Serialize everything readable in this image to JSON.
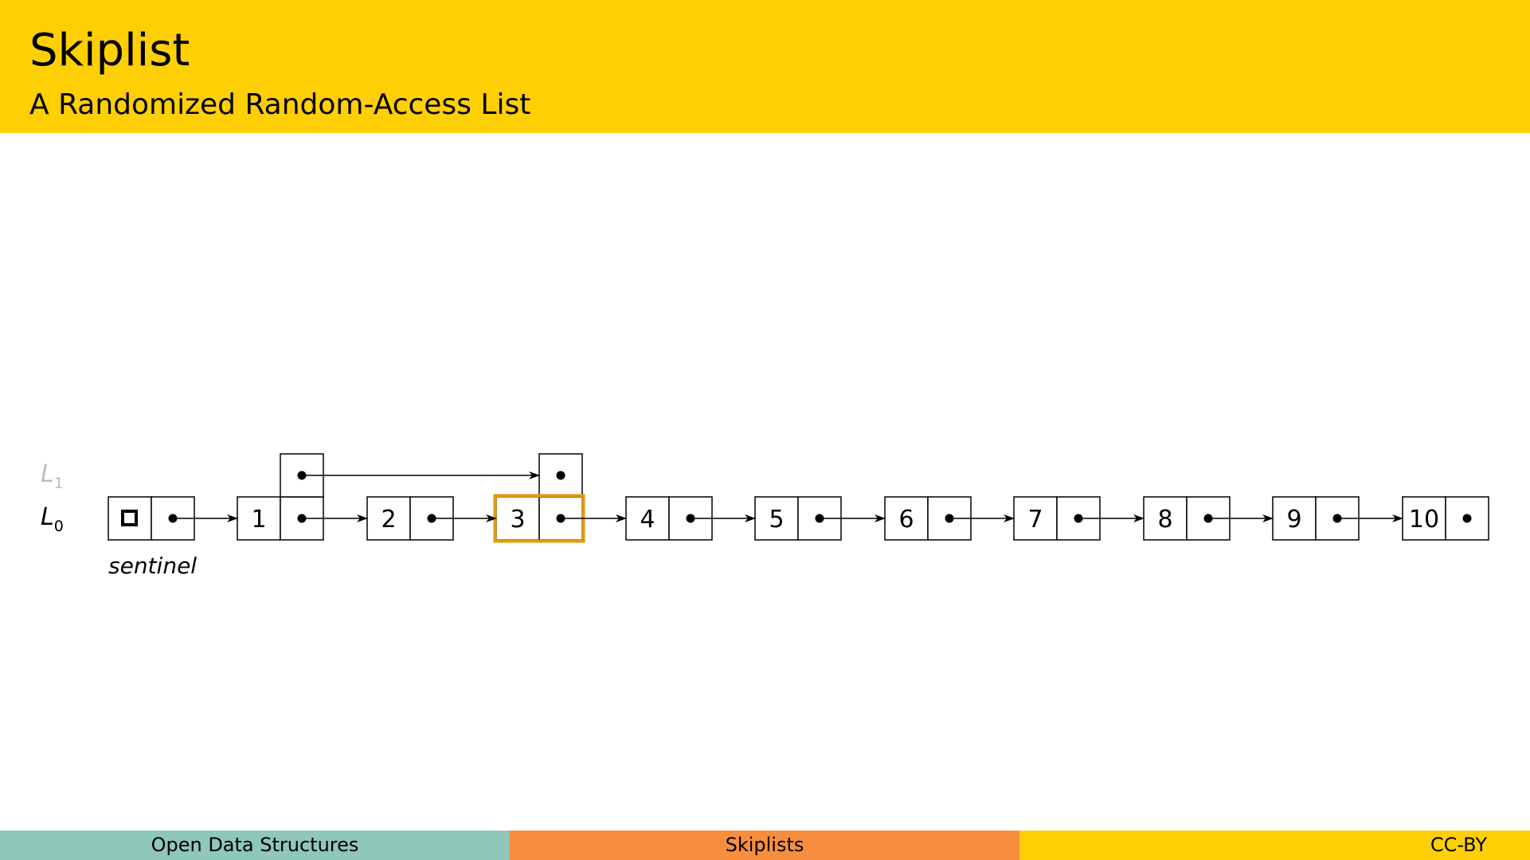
{
  "header": {
    "title": "Skiplist",
    "subtitle": "A Randomized Random-Access List"
  },
  "diagram": {
    "levels": [
      {
        "name": "L",
        "sub": "1",
        "active": false
      },
      {
        "name": "L",
        "sub": "0",
        "active": true
      }
    ],
    "sentinel_label": "sentinel",
    "nodes": [
      "1",
      "2",
      "3",
      "4",
      "5",
      "6",
      "7",
      "8",
      "9",
      "10"
    ],
    "tall_nodes": [
      "1",
      "3"
    ],
    "highlighted_node": "3",
    "colors": {
      "highlight": "#e39a0a",
      "inactive_level": "#bdbdbd"
    }
  },
  "footer": {
    "left": "Open Data Structures",
    "middle": "Skiplists",
    "right": "CC-BY"
  },
  "colors": {
    "header": "#ffcf05",
    "footer_left": "#8fc7b8",
    "footer_middle": "#f68e3e",
    "footer_right": "#ffcf05"
  }
}
